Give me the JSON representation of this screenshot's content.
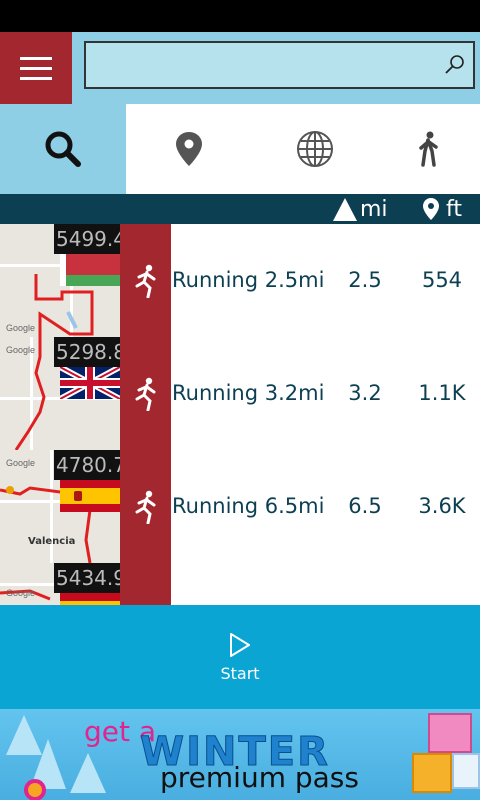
{
  "search": {
    "value": "",
    "placeholder": ""
  },
  "tabs": [
    {
      "name": "search",
      "icon": "search-icon",
      "active": true
    },
    {
      "name": "location",
      "icon": "map-pin-icon",
      "active": false
    },
    {
      "name": "globe",
      "icon": "globe-icon",
      "active": false
    },
    {
      "name": "walk",
      "icon": "walking-person-icon",
      "active": false
    }
  ],
  "header": {
    "distance_unit": "mi",
    "elevation_unit": "ft"
  },
  "activities": [
    {
      "elevation": "5499.4",
      "flag": "Belarus",
      "name": "Running 2.5mi",
      "distance": "2.5",
      "elev_gain": "554"
    },
    {
      "elevation": "5298.8",
      "flag": "United Kingdom",
      "name": "Running 3.2mi",
      "distance": "3.2",
      "elev_gain": "1.1K"
    },
    {
      "elevation": "4780.7",
      "flag": "Spain",
      "name": "Running 6.5mi",
      "distance": "6.5",
      "elev_gain": "3.6K"
    },
    {
      "elevation": "5434.9",
      "flag": "Spain",
      "name": "",
      "distance": "",
      "elev_gain": ""
    }
  ],
  "map_labels": {
    "provider": "Google",
    "city": "Valencia"
  },
  "start": {
    "label": "Start"
  },
  "ad": {
    "line1": "get a",
    "line2": "WINTER",
    "line3": "premium pass"
  },
  "colors": {
    "accent_red": "#a3272e",
    "header_navy": "#0d3f52",
    "sky": "#8ecfe6",
    "start_blue": "#0ba5d4"
  }
}
